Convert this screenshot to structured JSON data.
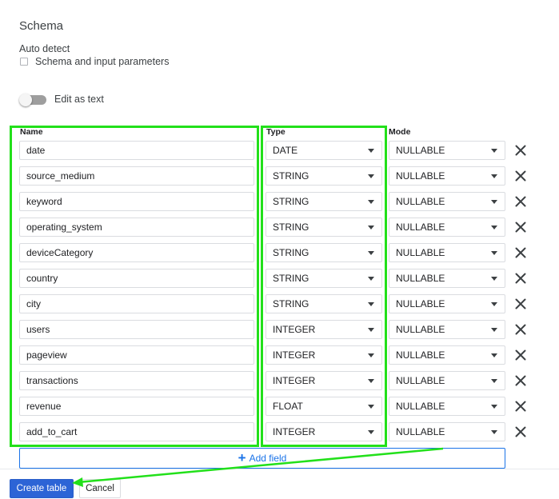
{
  "schema": {
    "title": "Schema",
    "auto_detect_label": "Auto detect",
    "auto_detect_checkbox_label": "Schema and input parameters",
    "auto_detect_checked": false,
    "edit_as_text_label": "Edit as text",
    "edit_as_text_on": false
  },
  "columns": {
    "name": "Name",
    "type": "Type",
    "mode": "Mode"
  },
  "fields": [
    {
      "name": "date",
      "type": "DATE",
      "mode": "NULLABLE"
    },
    {
      "name": "source_medium",
      "type": "STRING",
      "mode": "NULLABLE"
    },
    {
      "name": "keyword",
      "type": "STRING",
      "mode": "NULLABLE"
    },
    {
      "name": "operating_system",
      "type": "STRING",
      "mode": "NULLABLE"
    },
    {
      "name": "deviceCategory",
      "type": "STRING",
      "mode": "NULLABLE"
    },
    {
      "name": "country",
      "type": "STRING",
      "mode": "NULLABLE"
    },
    {
      "name": "city",
      "type": "STRING",
      "mode": "NULLABLE"
    },
    {
      "name": "users",
      "type": "INTEGER",
      "mode": "NULLABLE"
    },
    {
      "name": "pageview",
      "type": "INTEGER",
      "mode": "NULLABLE"
    },
    {
      "name": "transactions",
      "type": "INTEGER",
      "mode": "NULLABLE"
    },
    {
      "name": "revenue",
      "type": "FLOAT",
      "mode": "NULLABLE"
    },
    {
      "name": "add_to_cart",
      "type": "INTEGER",
      "mode": "NULLABLE"
    }
  ],
  "add_field_label": "Add field",
  "actions": {
    "create_label": "Create table",
    "cancel_label": "Cancel"
  },
  "icons": {
    "remove": "close-icon",
    "add": "plus-icon",
    "dropdown": "caret-down-icon"
  },
  "colors": {
    "primary": "#2c64d6",
    "link": "#1a73e8",
    "annotation": "#22e01a"
  }
}
